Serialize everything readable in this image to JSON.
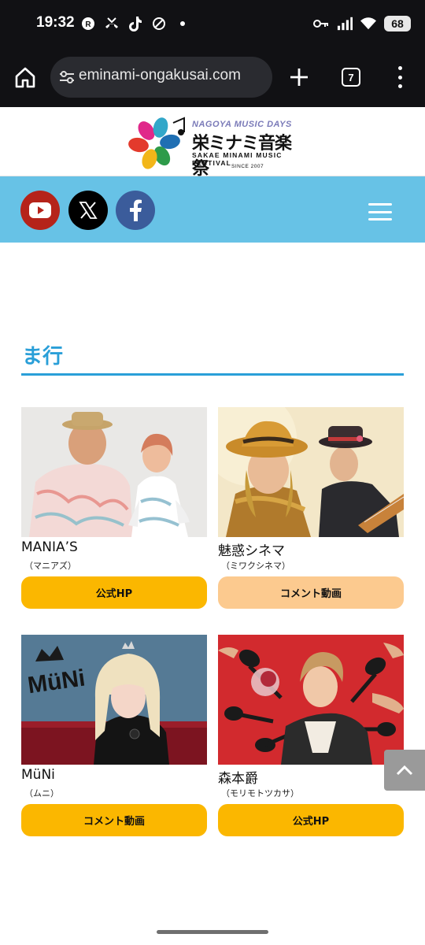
{
  "status_bar": {
    "time": "19:32",
    "battery": "68"
  },
  "browser": {
    "url": "eminami-ongakusai.com",
    "tab_count": "7"
  },
  "site": {
    "logo": {
      "en_top": "NAGOYA MUSIC DAYS",
      "jp": "栄ミナミ音楽祭",
      "en_bottom": "SAKAE MINAMI MUSIC FESTIVAL",
      "since": "SINCE 2007"
    },
    "social": {
      "youtube_icon": "youtube-icon",
      "x_icon": "x-icon",
      "facebook_icon": "facebook-icon"
    }
  },
  "section": {
    "title": "ま行"
  },
  "artists": [
    {
      "name": "MANIA’S",
      "kana": "（マニアズ）",
      "button": "公式HP"
    },
    {
      "name": "魅惑シネマ",
      "kana": "（ミワクシネマ）",
      "button": "コメント動画"
    },
    {
      "name": "MüNi",
      "kana": "（ムニ）",
      "button": "コメント動画",
      "photo_logo": "MüNi"
    },
    {
      "name": "森本爵",
      "kana": "（モリモトツカサ）",
      "button": "公式HP"
    }
  ],
  "colors": {
    "accent": "#2a9fd8",
    "nav_bg": "#67c2e6",
    "button_primary": "#fbb700",
    "button_light": "#fcca8f"
  }
}
